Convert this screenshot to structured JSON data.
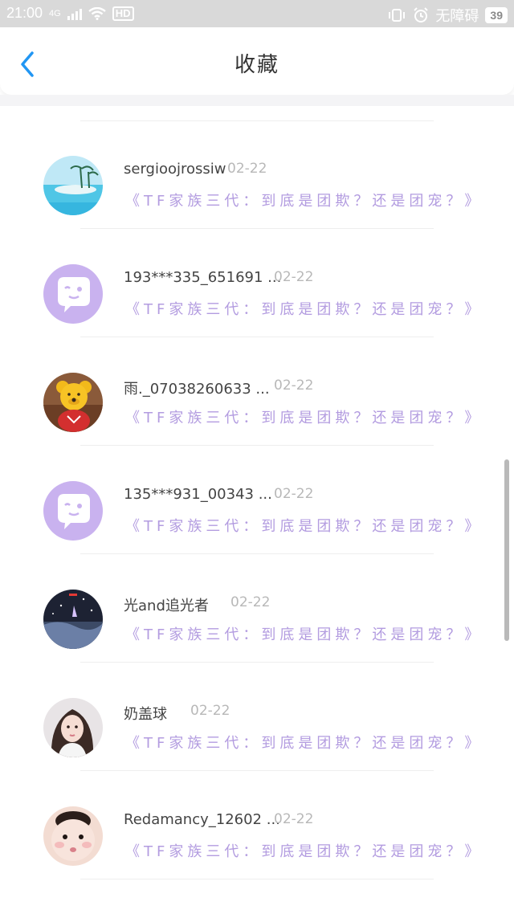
{
  "status_bar": {
    "time": "21:00",
    "network": "4G",
    "no_disturb_text": "无障碍",
    "battery": "39"
  },
  "header": {
    "title": "收藏",
    "back_icon": "chevron-left-icon",
    "accent_color": "#2196f3"
  },
  "items": [
    {
      "name": "sergioojrossiw",
      "date": "02-22",
      "link": "《TF家族三代：到底是团欺？还是团宠？》",
      "avatar": "beach-photo"
    },
    {
      "name": "193***335_651691 ...",
      "date": "02-22",
      "link": "《TF家族三代：到底是团欺？还是团宠？》",
      "avatar": "default-chat-avatar"
    },
    {
      "name": "雨._07038260633 ...",
      "date": "02-22",
      "link": "《TF家族三代：到底是团欺？还是团宠？》",
      "avatar": "bear-photo"
    },
    {
      "name": "135***931_00343 ...",
      "date": "02-22",
      "link": "《TF家族三代：到底是团欺？还是团宠？》",
      "avatar": "default-chat-avatar"
    },
    {
      "name": "光and追光者",
      "date": "02-22",
      "link": "《TF家族三代：到底是团欺？还是团宠？》",
      "avatar": "night-photo"
    },
    {
      "name": "奶盖球",
      "date": "02-22",
      "link": "《TF家族三代：到底是团欺？还是团宠？》",
      "avatar": "girl-photo"
    },
    {
      "name": "Redamancy_12602 ...",
      "date": "02-22",
      "link": "《TF家族三代：到底是团欺？还是团宠？》",
      "avatar": "baby-photo"
    }
  ],
  "colors": {
    "link": "#b39ce0",
    "default_avatar_bg": "#c9b2ef"
  }
}
